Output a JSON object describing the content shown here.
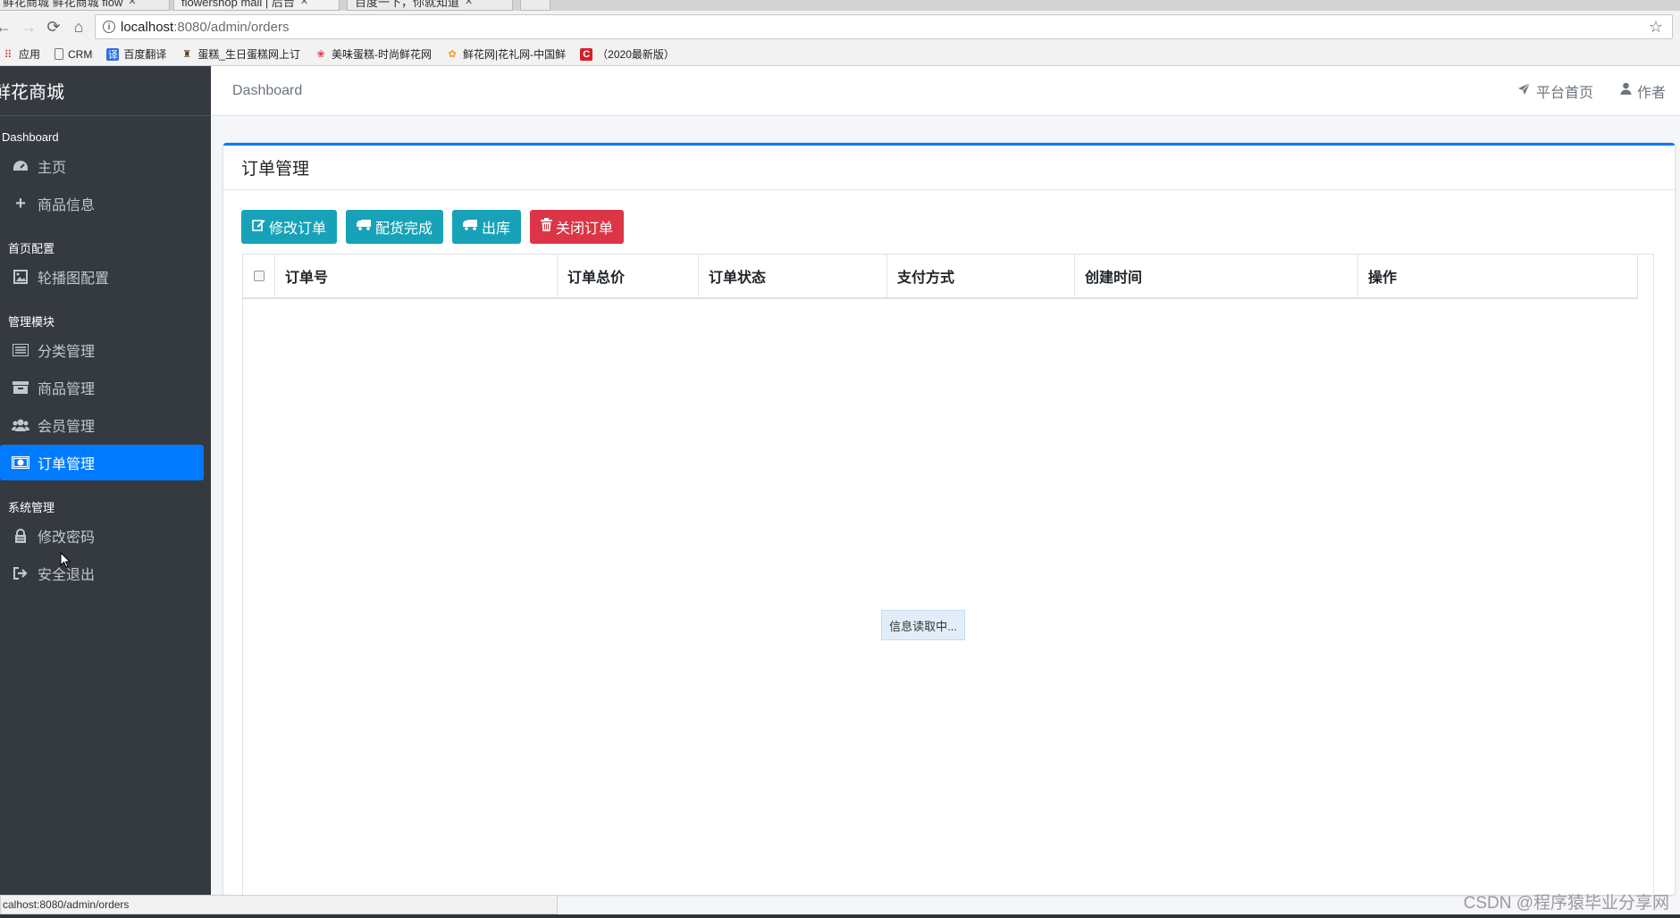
{
  "browser": {
    "tabs": [
      {
        "title": "鲜花商城 鲜花商城 flow",
        "active": false
      },
      {
        "title": "flowershop mall | 后台",
        "active": true
      },
      {
        "title": "百度一下，你就知道",
        "active": false
      }
    ],
    "url_host": "localhost",
    "url_path": ":8080/admin/orders",
    "bookmarks": [
      {
        "label": "应用",
        "icon": "apps-grid-icon"
      },
      {
        "label": "CRM",
        "icon": "page-icon"
      },
      {
        "label": "百度翻译",
        "icon": "translate-icon"
      },
      {
        "label": "蛋糕_生日蛋糕网上订",
        "icon": "cake-icon"
      },
      {
        "label": "美味蛋糕-时尚鲜花网",
        "icon": "flower-icon"
      },
      {
        "label": "鲜花网|花礼网-中国鲜",
        "icon": "flower-orange-icon"
      },
      {
        "label": "（2020最新版）",
        "icon": "c-red-icon"
      }
    ],
    "status_url": "calhost:8080/admin/orders"
  },
  "sidebar": {
    "brand": "鲜花商城",
    "sections": [
      {
        "header": "Dashboard",
        "items": [
          {
            "label": "主页",
            "icon": "dashboard-icon",
            "active": false
          },
          {
            "label": "商品信息",
            "icon": "plus-icon",
            "active": false
          }
        ]
      },
      {
        "header": "首页配置",
        "items": [
          {
            "label": "轮播图配置",
            "icon": "image-icon",
            "active": false
          }
        ]
      },
      {
        "header": "管理模块",
        "items": [
          {
            "label": "分类管理",
            "icon": "list-icon",
            "active": false
          },
          {
            "label": "商品管理",
            "icon": "archive-icon",
            "active": false
          },
          {
            "label": "会员管理",
            "icon": "users-icon",
            "active": false
          },
          {
            "label": "订单管理",
            "icon": "money-icon",
            "active": true
          }
        ]
      },
      {
        "header": "系统管理",
        "items": [
          {
            "label": "修改密码",
            "icon": "lock-icon",
            "active": false
          },
          {
            "label": "安全退出",
            "icon": "sign-out-icon",
            "active": false
          }
        ]
      }
    ]
  },
  "topnav": {
    "breadcrumb": "Dashboard",
    "platform_home": "平台首页",
    "author": "作者"
  },
  "card": {
    "title": "订单管理",
    "buttons": [
      {
        "label": "修改订单",
        "icon": "edit-icon",
        "variant": "info"
      },
      {
        "label": "配货完成",
        "icon": "truck-icon",
        "variant": "info"
      },
      {
        "label": "出库",
        "icon": "truck-icon",
        "variant": "info"
      },
      {
        "label": "关闭订单",
        "icon": "trash-icon",
        "variant": "danger"
      }
    ],
    "columns": [
      "订单号",
      "订单总价",
      "订单状态",
      "支付方式",
      "创建时间",
      "操作"
    ],
    "loading_text": "信息读取中..."
  },
  "watermark": "CSDN @程序猿毕业分享网",
  "colors": {
    "sidebar_bg": "#343a40",
    "accent": "#007bff",
    "info": "#17a2b8",
    "danger": "#dc3545"
  }
}
